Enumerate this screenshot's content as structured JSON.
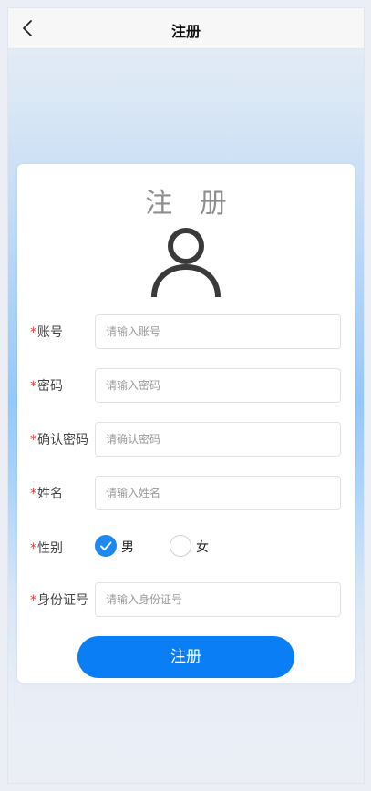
{
  "navbar": {
    "title": "注册"
  },
  "form": {
    "heading": "注 册",
    "required_mark": "*",
    "fields": [
      {
        "label": "账号",
        "placeholder": "请输入账号",
        "value": ""
      },
      {
        "label": "密码",
        "placeholder": "请输入密码",
        "value": ""
      },
      {
        "label": "确认密码",
        "placeholder": "请确认密码",
        "value": ""
      },
      {
        "label": "姓名",
        "placeholder": "请输入姓名",
        "value": ""
      }
    ],
    "gender": {
      "label": "性别",
      "options": [
        {
          "label": "男",
          "selected": true
        },
        {
          "label": "女",
          "selected": false
        }
      ]
    },
    "id_number": {
      "label": "身份证号",
      "placeholder": "请输入身份证号",
      "value": ""
    },
    "submit_label": "注册"
  },
  "icons": {
    "back": "chevron-left-icon",
    "avatar": "user-icon",
    "check": "check-icon"
  },
  "colors": {
    "accent": "#0a7ff5",
    "required": "#e53935",
    "radio_checked": "#1e88f0"
  }
}
